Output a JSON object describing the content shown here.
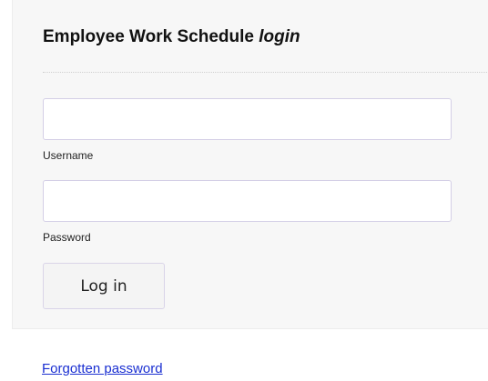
{
  "form": {
    "title_main": "Employee Work Schedule ",
    "title_emphasis": "login",
    "username": {
      "label": "Username",
      "value": "",
      "placeholder": ""
    },
    "password": {
      "label": "Password",
      "value": "",
      "placeholder": ""
    },
    "submit_label": "Log in"
  },
  "links": {
    "forgot_password": "Forgotten password"
  },
  "colors": {
    "panel_background": "#f7f7f7",
    "input_border": "#d4cfe6",
    "link": "#1a2fd1"
  }
}
